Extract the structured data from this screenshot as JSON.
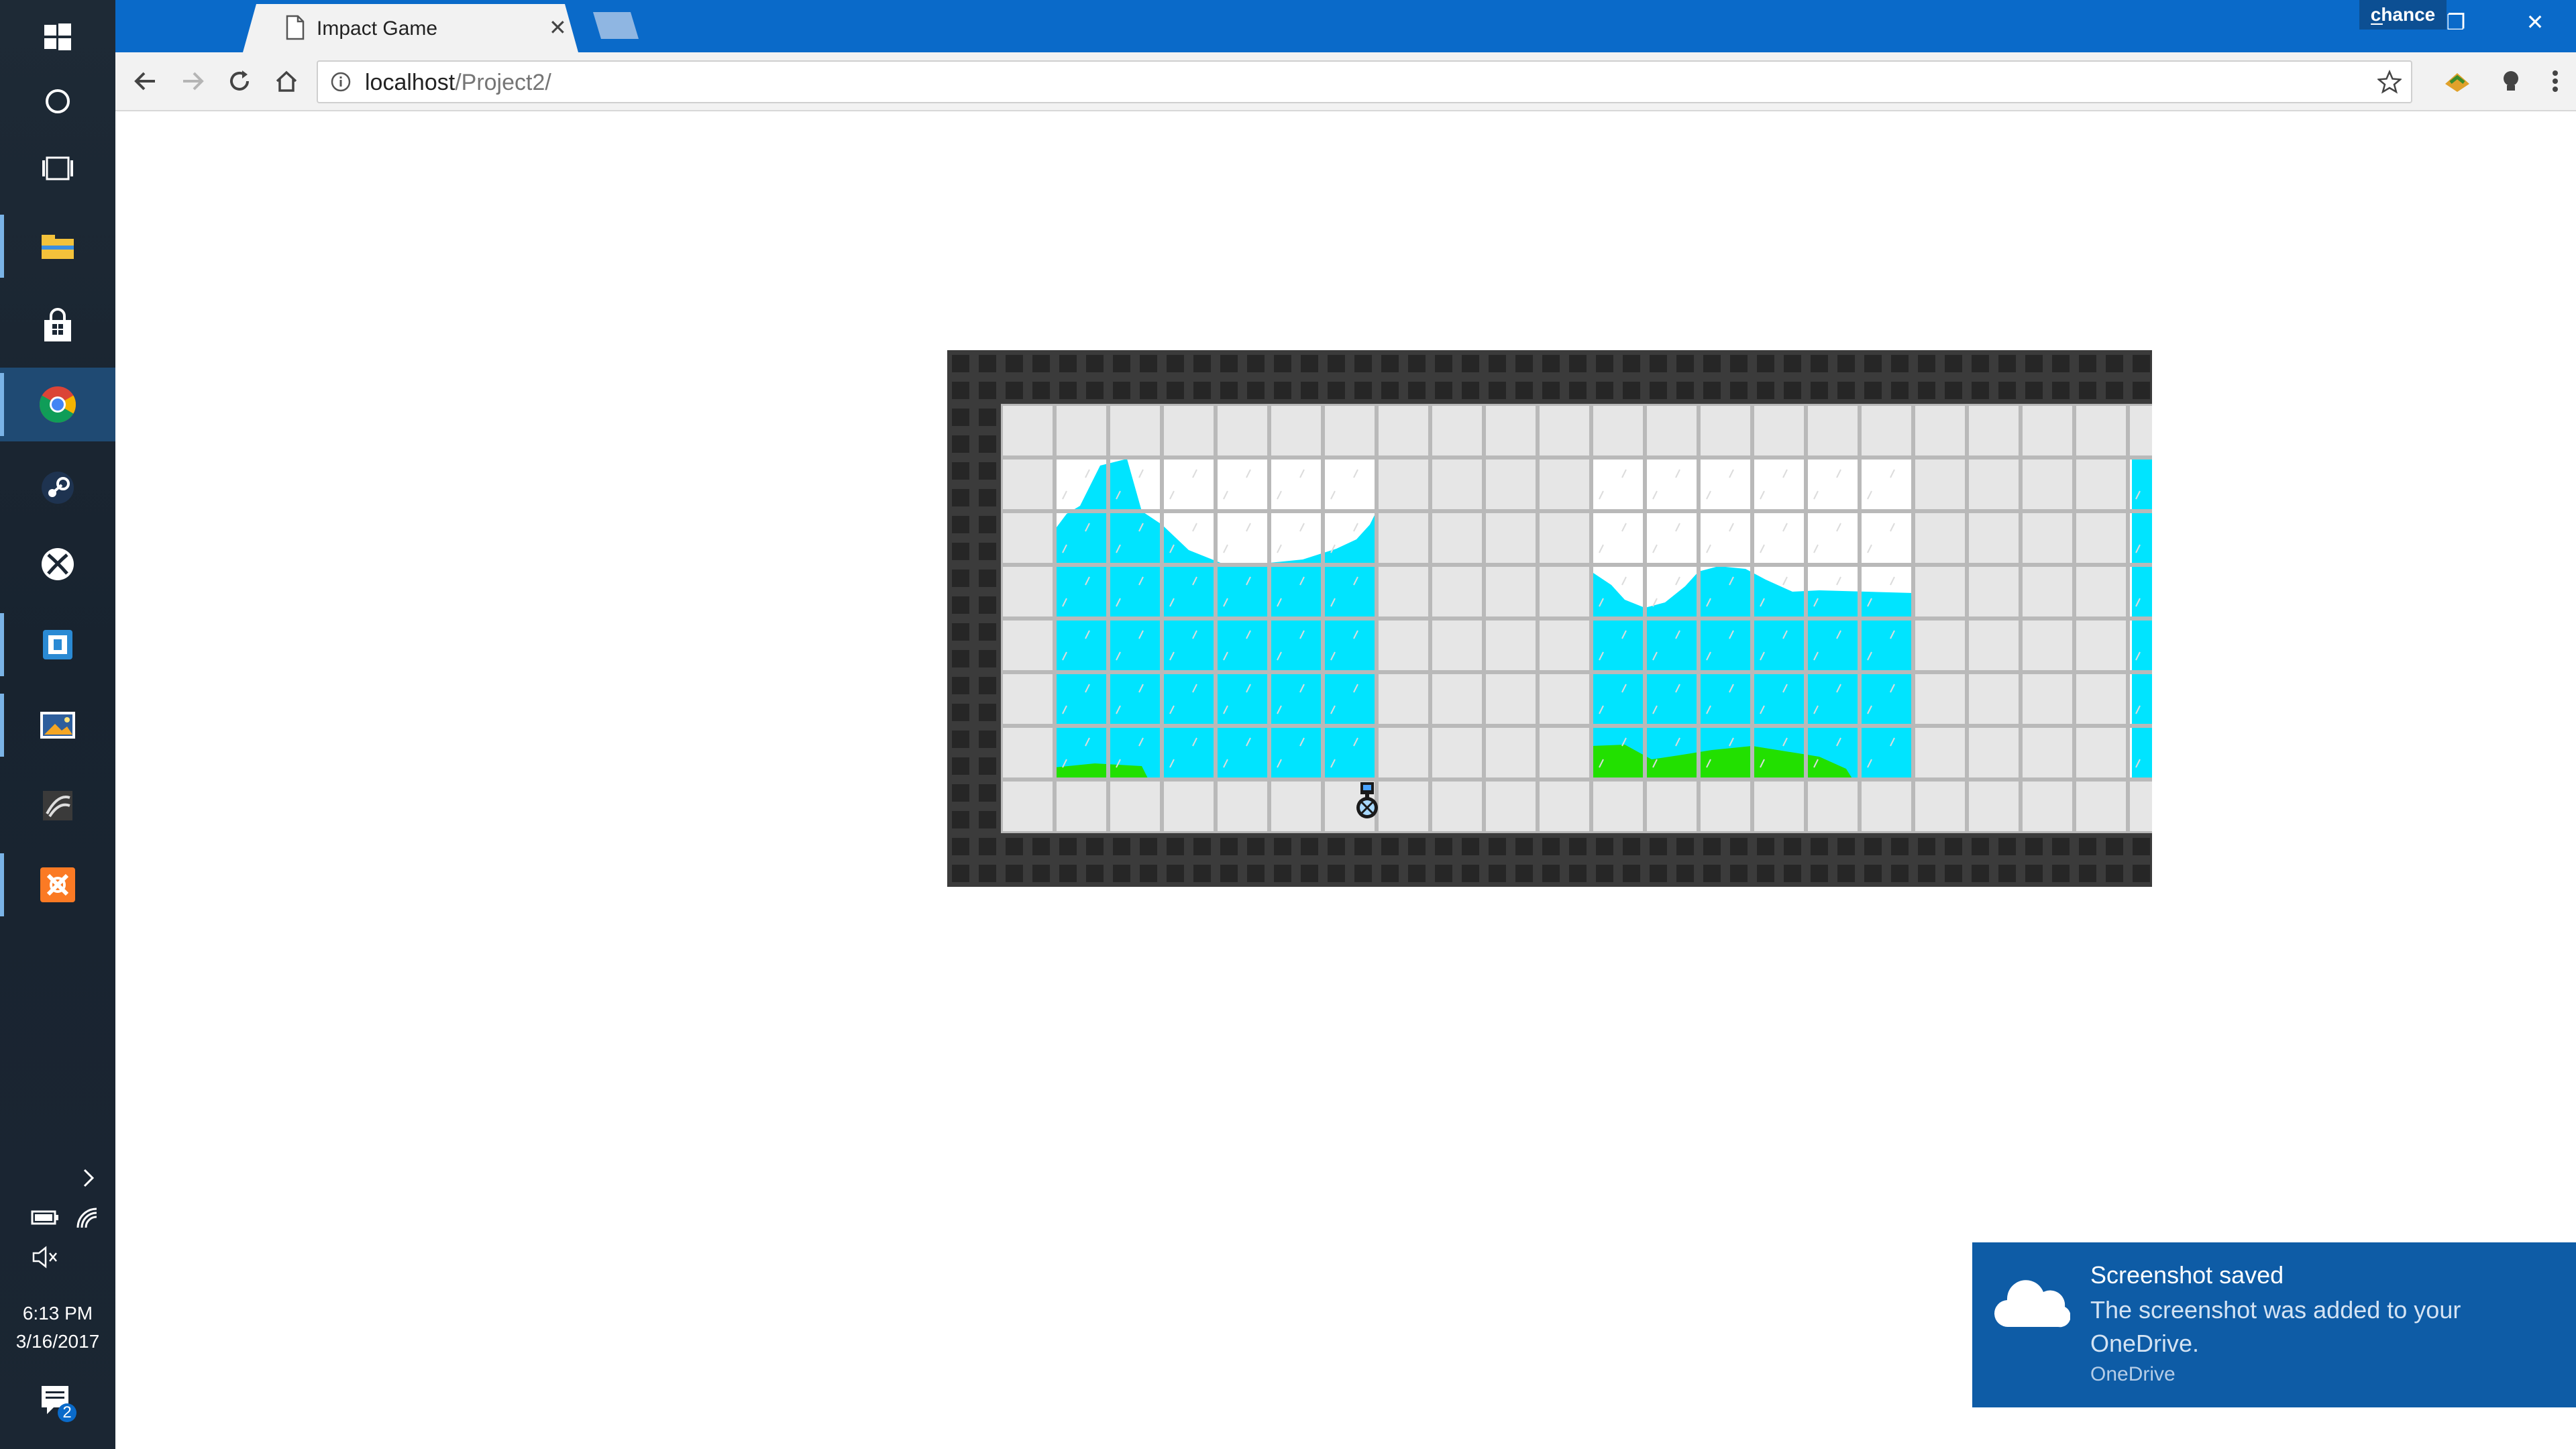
{
  "taskbar": {
    "apps": [
      {
        "name": "windows-start-icon"
      },
      {
        "name": "cortana-icon"
      },
      {
        "name": "task-view-icon"
      },
      {
        "name": "file-explorer-icon"
      },
      {
        "name": "store-icon"
      },
      {
        "name": "chrome-icon",
        "active": true
      },
      {
        "name": "steam-icon"
      },
      {
        "name": "xbox-icon"
      },
      {
        "name": "app-icon"
      },
      {
        "name": "photos-icon"
      },
      {
        "name": "gpu-app-icon"
      },
      {
        "name": "xampp-icon"
      }
    ],
    "time": "6:13 PM",
    "date": "3/16/2017",
    "notifications_count": "2"
  },
  "browser": {
    "tab_title": "Impact Game",
    "profile_name": "chance",
    "url_host": "localhost",
    "url_path": "/Project2/",
    "window_controls": {
      "minimize": "–",
      "restore": "❐",
      "close": "✕"
    }
  },
  "game": {
    "colors": {
      "wall": "#3b3b3b",
      "wall_tile": "#2a2a2a",
      "floor": "#e6e6e6",
      "grid": "#b9b9b9",
      "water": "#00e4ff",
      "sky": "#ffffff",
      "grass": "#22e000"
    }
  },
  "toast": {
    "title": "Screenshot saved",
    "body": "The screenshot was added to your OneDrive.",
    "app": "OneDrive"
  }
}
